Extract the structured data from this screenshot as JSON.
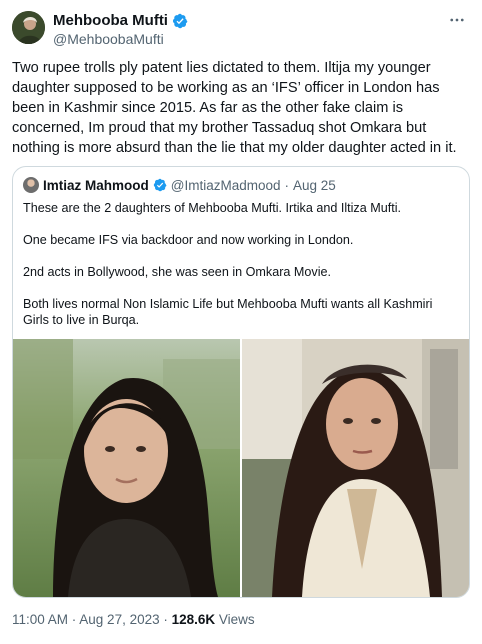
{
  "author": {
    "display_name": "Mehbooba Mufti",
    "handle": "@MehboobaMufti",
    "verified": true
  },
  "tweet_text": "Two rupee trolls ply patent lies dictated to them. Iltija my younger daughter supposed to be working as an ‘IFS’ officer in London has been in Kashmir since 2015. As far as the other fake claim is concerned, Im proud that my brother Tassaduq shot Omkara but nothing is more absurd than the lie that my older daughter acted in it.",
  "quoted_tweet": {
    "display_name": "Imtiaz Mahmood",
    "handle": "@ImtiazMadmood",
    "separator": "·",
    "date": "Aug 25",
    "verified": true,
    "text": "These are the 2 daughters of Mehbooba Mufti. Irtika and Iltiza Mufti.\n\nOne became IFS via backdoor and now working in London.\n\n2nd acts in Bollywood, she was seen in Omkara Movie.\n\nBoth lives normal Non Islamic Life but Mehbooba Mufti wants all Kashmiri Girls to live in Burqa."
  },
  "meta": {
    "timestamp": "11:00 AM · Aug 27, 2023 · ",
    "views_count": "128.6K",
    "views_label": " Views"
  },
  "icons": {
    "verified": "verified-badge-icon",
    "more": "more-options-icon"
  },
  "colors": {
    "text_primary": "#0f1419",
    "text_secondary": "#536471",
    "verified_blue": "#1d9bf0",
    "border": "#cfd9de"
  }
}
